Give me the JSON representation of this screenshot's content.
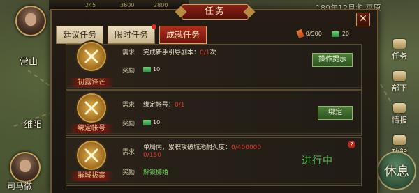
{
  "map": {
    "cities": [
      "常山",
      "维阳"
    ],
    "date": "189年12月冬 平原",
    "resources": [
      "245",
      "3600",
      "2800"
    ],
    "portrait_label": "司马徽"
  },
  "side_menu": [
    {
      "label": "任务",
      "icon": "quest-icon"
    },
    {
      "label": "部下",
      "icon": "troops-icon"
    },
    {
      "label": "情报",
      "icon": "intel-icon"
    },
    {
      "label": "功能",
      "icon": "function-icon"
    }
  ],
  "rest_button": "休息",
  "dialog": {
    "title": "任务",
    "close": "✕",
    "tabs": [
      {
        "label": "廷议任务",
        "active": false,
        "dot": false
      },
      {
        "label": "限时任务",
        "active": false,
        "dot": true
      },
      {
        "label": "成就任务",
        "active": true,
        "dot": false
      }
    ],
    "counters": {
      "scroll": "0/500",
      "bill": "20"
    },
    "labels": {
      "requirement": "需求",
      "reward": "奖励"
    },
    "tasks": [
      {
        "badge_label": "初露锋芒",
        "req_text": "完成新手引导剧本：",
        "req_progress": "0/1",
        "req_suffix": "次",
        "reward": "10",
        "button": "操作提示"
      },
      {
        "badge_label": "绑定帐号",
        "req_text": "绑定帐号：",
        "req_progress": "0/1",
        "req_suffix": "",
        "reward": "10",
        "button": "绑定"
      },
      {
        "badge_label": "摧城拔寨",
        "req_text": "单局内，累积攻破城池耐久度：",
        "req_progress": "0/400000",
        "req_line2": "0/150",
        "reward_text": "解锁挪婚",
        "status": "进行中",
        "help": "?"
      }
    ]
  }
}
